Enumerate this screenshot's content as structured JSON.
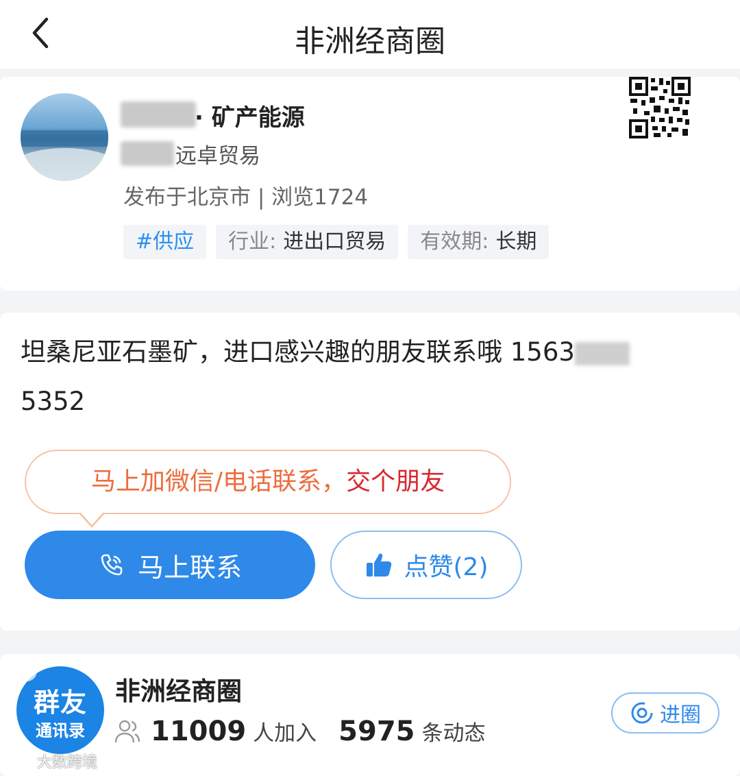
{
  "header": {
    "title": "非洲经商圈"
  },
  "poster": {
    "name_suffix": "· 矿产能源",
    "company_suffix": "远卓贸易",
    "meta": "发布于北京市 | 浏览1724",
    "tags": {
      "supply": "#供应",
      "industry_key": "行业:",
      "industry_value": "进出口贸易",
      "validity_key": "有效期:",
      "validity_value": "长期"
    }
  },
  "post": {
    "text_part1": "坦桑尼亚石墨矿，进口感兴趣的朋友联系哦 1563",
    "text_part2": "5352",
    "bubble_orange": "马上加微信/电话联系，",
    "bubble_red": "交个朋友",
    "contact_label": "马上联系",
    "like_label": "点赞(2)"
  },
  "circle": {
    "logo_line1": "群友",
    "logo_line2": "通讯录",
    "name": "非洲经商圈",
    "members_count": "11009",
    "members_label": "人加入",
    "posts_count": "5975",
    "posts_label": "条动态",
    "join_label": "进圈"
  },
  "watermark": "大数跨境",
  "colors": {
    "primary_blue": "#2e89e9",
    "bubble_orange": "#ec6d3d",
    "bubble_red": "#d9262d"
  }
}
